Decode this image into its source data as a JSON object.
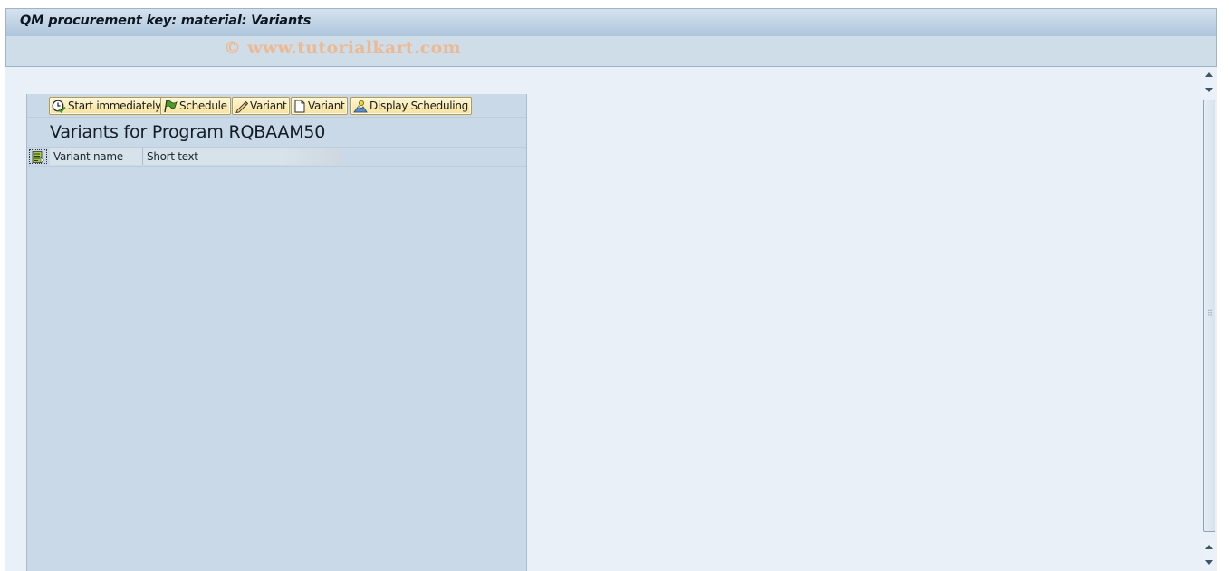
{
  "window": {
    "title": "QM procurement key: material: Variants",
    "watermark": "© www.tutorialkart.com"
  },
  "toolbar": {
    "buttons": [
      {
        "label": "Start immediately",
        "icon": "clock-check-icon"
      },
      {
        "label": "Schedule",
        "icon": "flag-icon"
      },
      {
        "label": "Variant",
        "icon": "pencil-icon"
      },
      {
        "label": "Variant",
        "icon": "document-icon"
      },
      {
        "label": "Display Scheduling",
        "icon": "person-mountain-icon"
      }
    ]
  },
  "main": {
    "heading": "Variants for Program RQBAAM50",
    "table": {
      "columns": [
        "Variant name",
        "Short text"
      ],
      "rows": []
    }
  },
  "colors": {
    "panel_bg": "#cad9e7",
    "page_bg": "#e9f0f7",
    "button_bg": "#f7e39f",
    "watermark": "#efb78c"
  }
}
